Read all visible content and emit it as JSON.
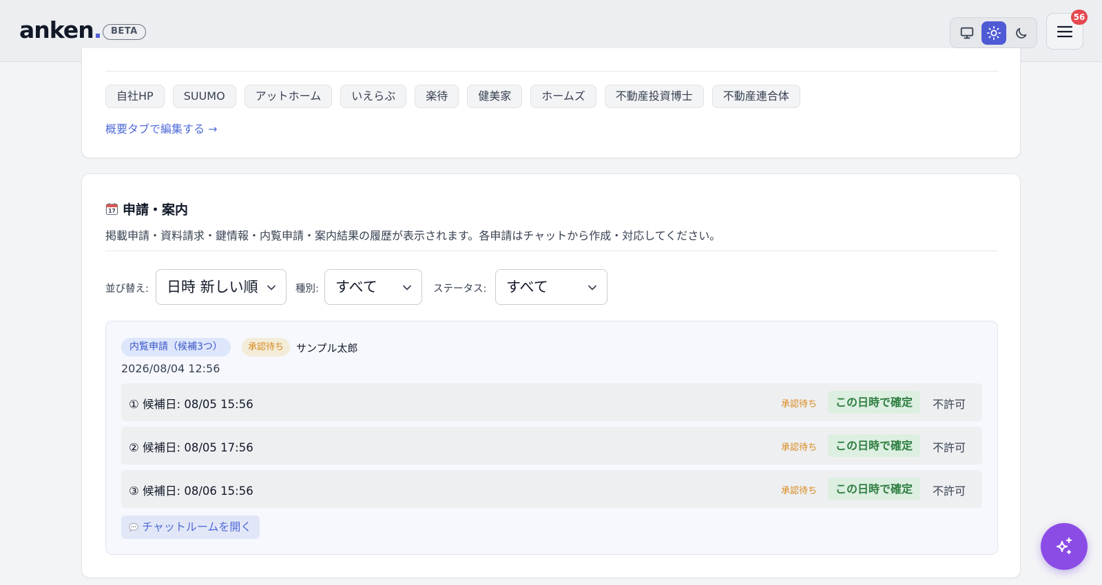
{
  "header": {
    "logo_text": "anken",
    "logo_dot": ".",
    "beta_label": "BETA",
    "notification_count": "56",
    "accent_color": "#4f5bd5"
  },
  "portals": {
    "tags": [
      "自社HP",
      "SUUMO",
      "アットホーム",
      "いえらぶ",
      "楽待",
      "健美家",
      "ホームズ",
      "不動産投資博士",
      "不動産連合体"
    ],
    "edit_link": "概要タブで編集する →"
  },
  "applications": {
    "title": "申請・案内",
    "description": "掲載申請・資料請求・鍵情報・内覧申請・案内結果の履歴が表示されます。各申請はチャットから作成・対応してください。",
    "filters": {
      "sort_label": "並び替え:",
      "sort_value": "日時 新しい順",
      "type_label": "種別:",
      "type_value": "すべて",
      "status_label": "ステータス:",
      "status_value": "すべて"
    },
    "request": {
      "type_pill": "内覧申請（候補3つ）",
      "status_pill": "承認待ち",
      "name": "サンプル太郎",
      "date": "2026/08/04 12:56",
      "candidates": [
        {
          "label": "① 候補日: 08/05 15:56",
          "status": "承認待ち",
          "confirm": "この日時で確定",
          "deny": "不許可"
        },
        {
          "label": "② 候補日: 08/05 17:56",
          "status": "承認待ち",
          "confirm": "この日時で確定",
          "deny": "不許可"
        },
        {
          "label": "③ 候補日: 08/06 15:56",
          "status": "承認待ち",
          "confirm": "この日時で確定",
          "deny": "不許可"
        }
      ],
      "chat_button": "チャットルームを開く"
    }
  }
}
